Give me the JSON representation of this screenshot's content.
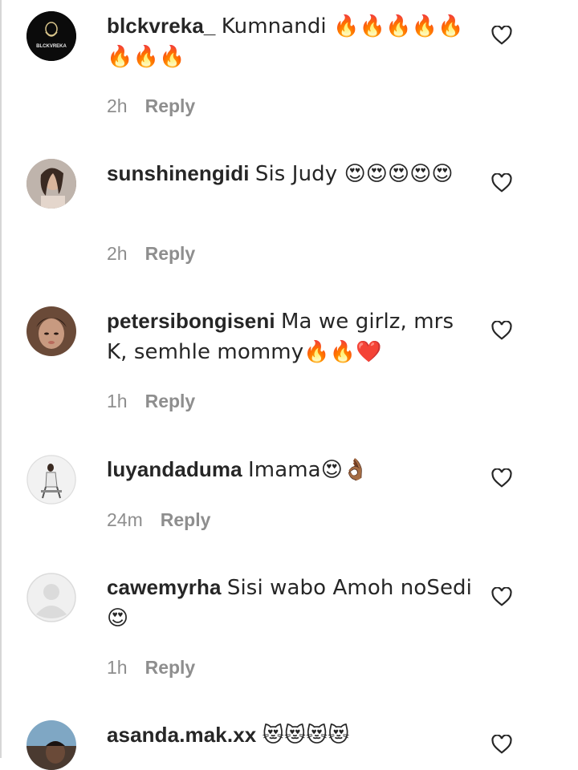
{
  "comments": [
    {
      "username": "blckvreka_",
      "text": "Kumnandi 🔥🔥🔥🔥🔥🔥🔥🔥",
      "time": "2h",
      "reply": "Reply",
      "avatar_text": "BLCKVREKA"
    },
    {
      "username": "sunshinengidi",
      "text": "Sis Judy 😍😍😍😍😍",
      "time": "2h",
      "reply": "Reply"
    },
    {
      "username": "petersibongiseni",
      "text": "Ma we girlz, mrs K, semhle mommy🔥🔥❤️",
      "time": "1h",
      "reply": "Reply"
    },
    {
      "username": "luyandaduma",
      "text": "Imama😍👌🏾",
      "time": "24m",
      "reply": "Reply"
    },
    {
      "username": "cawemyrha",
      "text": "Sisi wabo Amoh noSedi 😍",
      "time": "1h",
      "reply": "Reply"
    },
    {
      "username": "asanda.mak.xx",
      "text": "😻😻😻😻"
    }
  ]
}
